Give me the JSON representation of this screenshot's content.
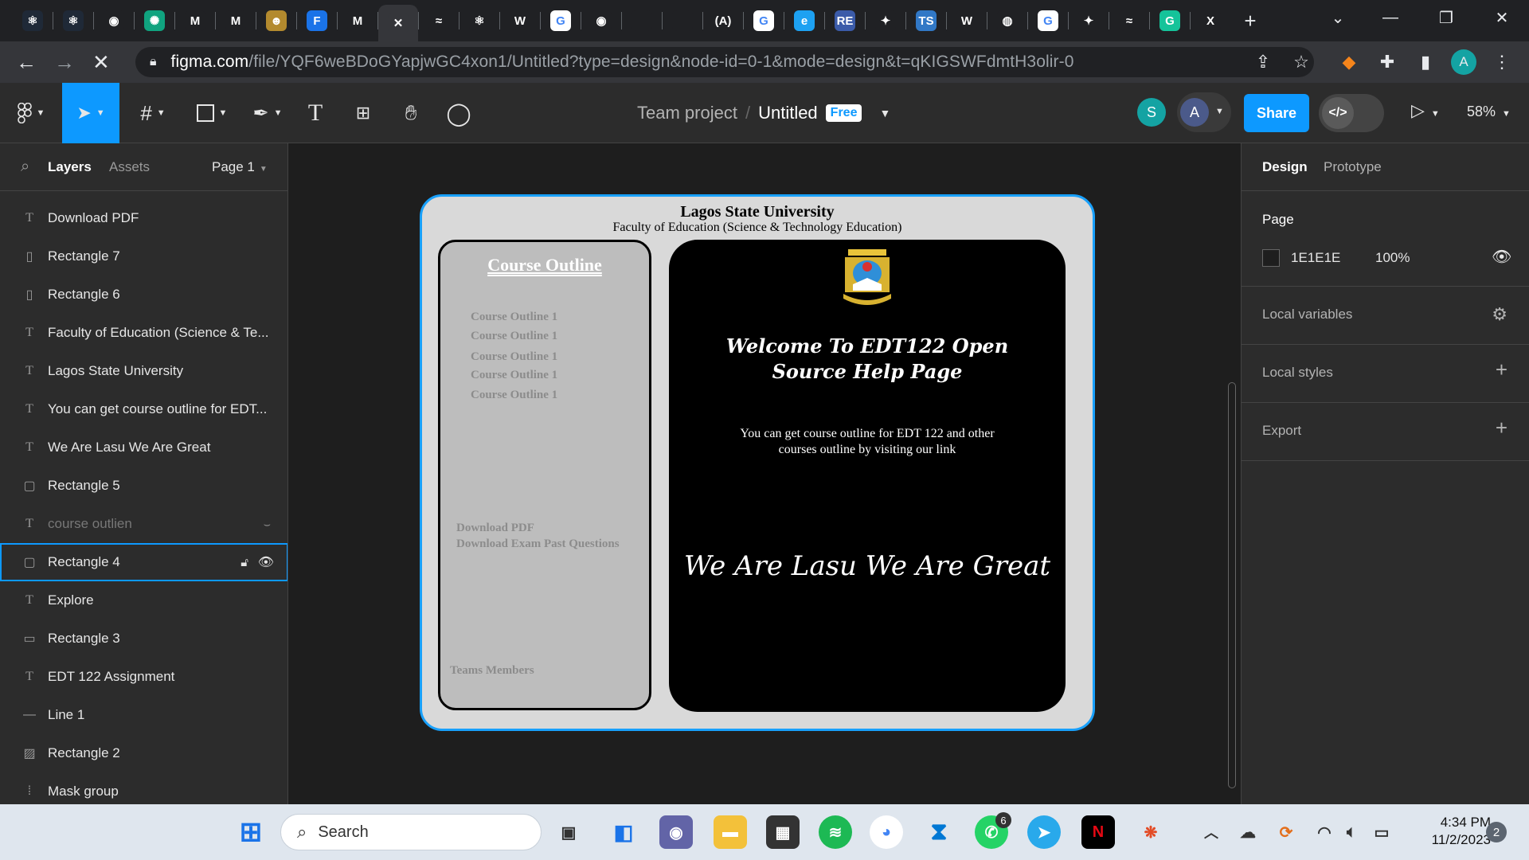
{
  "browser": {
    "tabs": [
      {
        "icon": "react-icon",
        "glyph": "⚛",
        "color": "#1f2937"
      },
      {
        "icon": "react-icon",
        "glyph": "⚛",
        "color": "#1f2937"
      },
      {
        "icon": "github-icon",
        "glyph": "◉",
        "color": "#202124"
      },
      {
        "icon": "chatgpt-icon",
        "glyph": "✺",
        "color": "#10a37f"
      },
      {
        "icon": "gmail-icon",
        "glyph": "M",
        "color": "#202124"
      },
      {
        "icon": "mui-icon",
        "glyph": "M",
        "color": "#202124"
      },
      {
        "icon": "avatar-tab-icon",
        "glyph": "☻",
        "color": "#b38a2e"
      },
      {
        "icon": "forms-icon",
        "glyph": "F",
        "color": "#1a73e8"
      },
      {
        "icon": "gmail-icon",
        "glyph": "M",
        "color": "#202124"
      },
      {
        "icon": "close-tab-icon",
        "glyph": "✕",
        "color": "#35363a"
      },
      {
        "icon": "tailwind-icon",
        "glyph": "≈",
        "color": "#202124"
      },
      {
        "icon": "react-icon",
        "glyph": "⚛",
        "color": "#202124"
      },
      {
        "icon": "w3schools-icon",
        "glyph": "W",
        "color": "#202124"
      },
      {
        "icon": "google-icon",
        "glyph": "G",
        "color": "#ffffff"
      },
      {
        "icon": "github-icon",
        "glyph": "◉",
        "color": "#202124"
      },
      {
        "icon": "blank-tab-icon",
        "glyph": "",
        "color": "#202124"
      },
      {
        "icon": "blank-tab-icon",
        "glyph": "",
        "color": "#202124"
      },
      {
        "icon": "regex-icon",
        "glyph": "(A)",
        "color": "#202124"
      },
      {
        "icon": "google-icon",
        "glyph": "G",
        "color": "#ffffff"
      },
      {
        "icon": "edge-icon",
        "glyph": "e",
        "color": "#1da1f2"
      },
      {
        "icon": "repo-icon",
        "glyph": "RE",
        "color": "#3b5ba9"
      },
      {
        "icon": "figma-icon",
        "glyph": "✦",
        "color": "#202124"
      },
      {
        "icon": "typescript-icon",
        "glyph": "TS",
        "color": "#3178c6"
      },
      {
        "icon": "w3schools-icon",
        "glyph": "W",
        "color": "#202124"
      },
      {
        "icon": "globe-icon",
        "glyph": "◍",
        "color": "#202124"
      },
      {
        "icon": "google-icon",
        "glyph": "G",
        "color": "#ffffff"
      },
      {
        "icon": "figma-icon",
        "glyph": "✦",
        "color": "#202124"
      },
      {
        "icon": "tailwind-icon",
        "glyph": "≈",
        "color": "#202124"
      },
      {
        "icon": "grammarly-icon",
        "glyph": "G",
        "color": "#15c39a"
      },
      {
        "icon": "xd-icon",
        "glyph": "X",
        "color": "#202124"
      }
    ],
    "url_host": "figma.com",
    "url_path": "/file/YQF6weBDoGYapjwGC4xon1/Untitled?type=design&node-id=0-1&mode=design&t=qKIGSWFdmtH3olir-0",
    "profile_initial": "A"
  },
  "toolbar": {
    "project": "Team project",
    "file_name": "Untitled",
    "plan_badge": "Free",
    "share_label": "Share",
    "zoom": "58%",
    "avatars": [
      {
        "initial": "S",
        "color": "#14a3a3"
      },
      {
        "initial": "A",
        "color": "#4b5a8a"
      }
    ]
  },
  "left_panel": {
    "tab_layers": "Layers",
    "tab_assets": "Assets",
    "page_selector": "Page 1",
    "layers": [
      {
        "type": "text",
        "name": "Download PDF"
      },
      {
        "type": "rect-v",
        "name": "Rectangle 7"
      },
      {
        "type": "rect-v",
        "name": "Rectangle 6"
      },
      {
        "type": "text",
        "name": "Faculty of Education (Science & Te..."
      },
      {
        "type": "text",
        "name": "Lagos State University"
      },
      {
        "type": "text",
        "name": "You can get course outline for EDT..."
      },
      {
        "type": "text",
        "name": "We Are Lasu We Are Great"
      },
      {
        "type": "rect",
        "name": "Rectangle 5"
      },
      {
        "type": "text",
        "name": "course outlien",
        "hidden": true
      },
      {
        "type": "rect",
        "name": "Rectangle 4",
        "selected": true
      },
      {
        "type": "text",
        "name": "Explore"
      },
      {
        "type": "rect-h",
        "name": "Rectangle 3"
      },
      {
        "type": "text",
        "name": "EDT 122 Assignment"
      },
      {
        "type": "line",
        "name": "Line 1"
      },
      {
        "type": "image",
        "name": "Rectangle 2"
      },
      {
        "type": "mask",
        "name": "Mask group"
      }
    ]
  },
  "design": {
    "header_title": "Lagos State University",
    "header_subtitle": "Faculty of  Education (Science & Technology Education)",
    "sidebar_heading": "Course Outline",
    "sidebar_items": [
      "Course Outline 1",
      "Course Outline 1",
      "Course Outline 1",
      "Course Outline 1",
      "Course Outline 1"
    ],
    "download_pdf": "Download PDF",
    "download_exam": "Download Exam Past Questions",
    "teams_members": "Teams Members",
    "welcome_line1": "Welcome To EDT122 Open",
    "welcome_line2": "Source Help Page",
    "outline_line1": "You can get course outline for EDT 122 and other",
    "outline_line2": "courses outline by visiting our link",
    "slogan": "We Are Lasu We Are Great"
  },
  "right_panel": {
    "tab_design": "Design",
    "tab_prototype": "Prototype",
    "page_label": "Page",
    "page_color": "1E1E1E",
    "page_opacity": "100%",
    "local_variables": "Local variables",
    "local_styles": "Local styles",
    "export": "Export"
  },
  "taskbar": {
    "search_placeholder": "Search",
    "time": "4:34 PM",
    "date": "11/2/2023",
    "notification_count": "2",
    "whatsapp_badge": "6"
  }
}
